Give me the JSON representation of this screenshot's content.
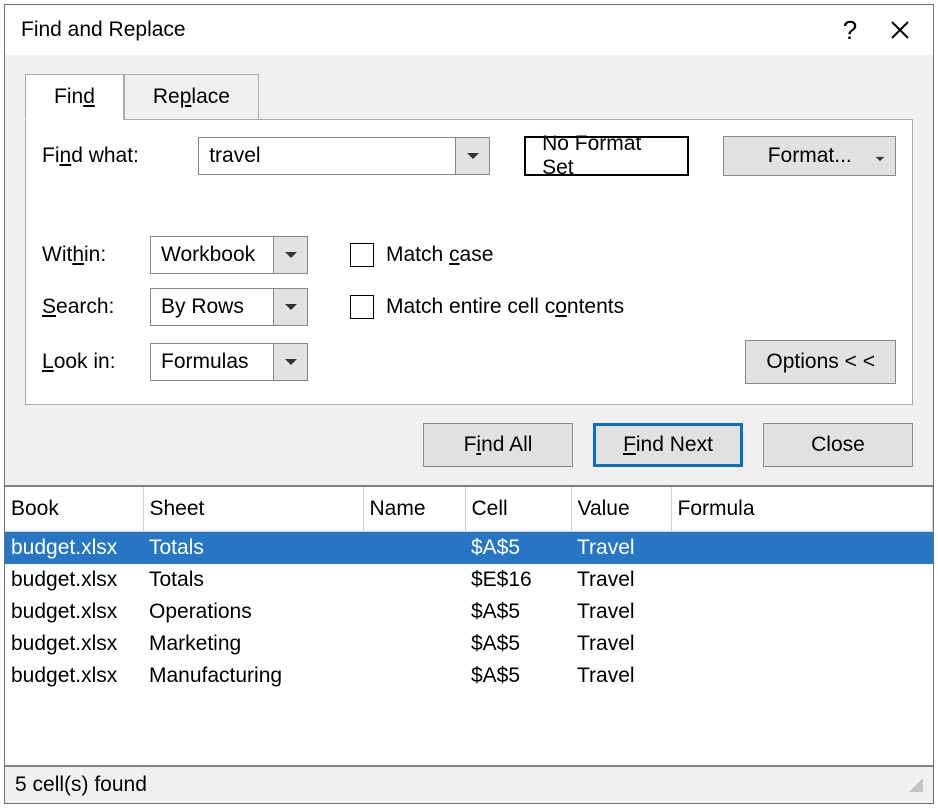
{
  "title": "Find and Replace",
  "tabs": {
    "find": "Find",
    "replace": "Replace"
  },
  "findwhat": {
    "label": "Find what:",
    "value": "travel"
  },
  "noformat": "No Format Set",
  "formatbtn": "Format...",
  "within": {
    "label": "Within:",
    "value": "Workbook"
  },
  "search": {
    "label": "Search:",
    "value": "By Rows"
  },
  "lookin": {
    "label": "Look in:",
    "value": "Formulas"
  },
  "matchcase": "Match case",
  "matchentire": "Match entire cell contents",
  "optionsbtn": "Options < <",
  "buttons": {
    "findall": "Find All",
    "findnext": "Find Next",
    "close": "Close"
  },
  "columns": {
    "book": "Book",
    "sheet": "Sheet",
    "name": "Name",
    "cell": "Cell",
    "value": "Value",
    "formula": "Formula"
  },
  "rows": [
    {
      "book": "budget.xlsx",
      "sheet": "Totals",
      "name": "",
      "cell": "$A$5",
      "value": "Travel",
      "formula": "",
      "selected": true
    },
    {
      "book": "budget.xlsx",
      "sheet": "Totals",
      "name": "",
      "cell": "$E$16",
      "value": "Travel",
      "formula": "",
      "selected": false
    },
    {
      "book": "budget.xlsx",
      "sheet": "Operations",
      "name": "",
      "cell": "$A$5",
      "value": "Travel",
      "formula": "",
      "selected": false
    },
    {
      "book": "budget.xlsx",
      "sheet": "Marketing",
      "name": "",
      "cell": "$A$5",
      "value": "Travel",
      "formula": "",
      "selected": false
    },
    {
      "book": "budget.xlsx",
      "sheet": "Manufacturing",
      "name": "",
      "cell": "$A$5",
      "value": "Travel",
      "formula": "",
      "selected": false
    }
  ],
  "status": "5 cell(s) found"
}
